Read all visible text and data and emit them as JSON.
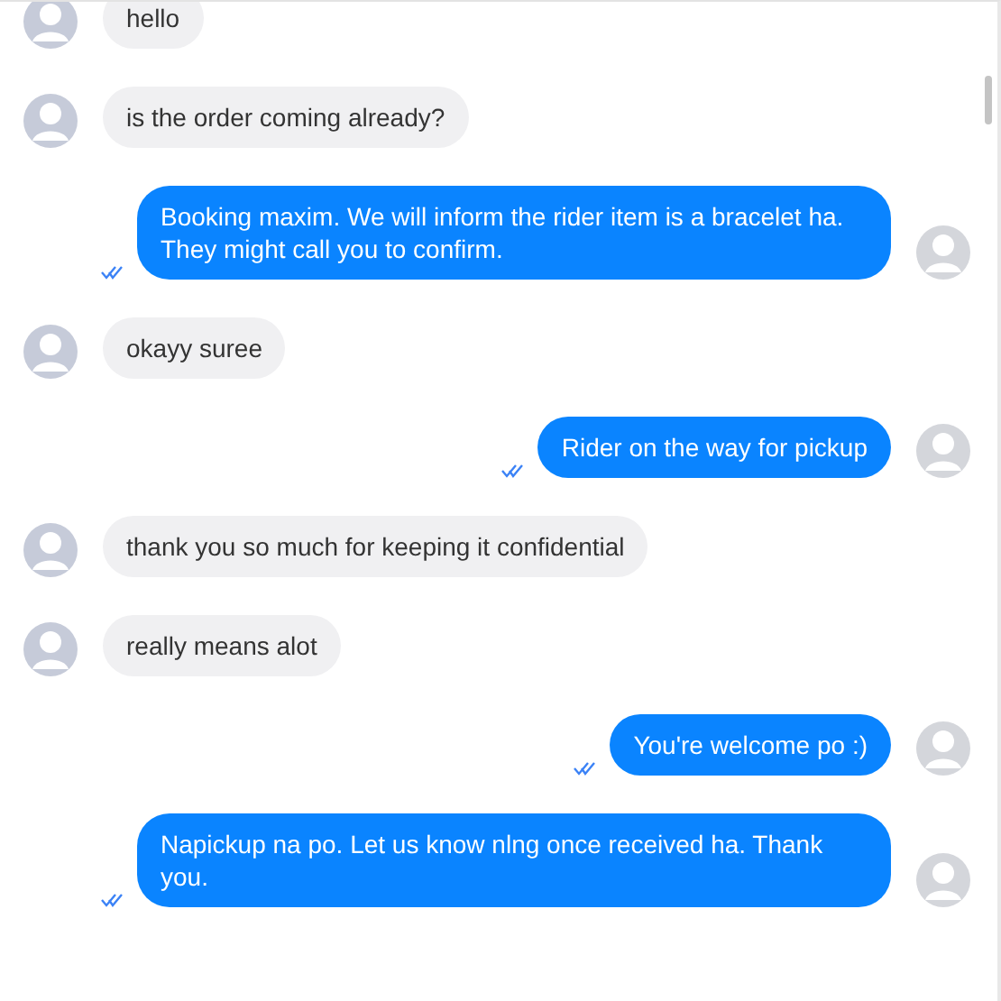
{
  "messages": [
    {
      "kind": "incoming",
      "text": "hello"
    },
    {
      "kind": "incoming",
      "text": "is the order coming already?"
    },
    {
      "kind": "outgoing",
      "text": "Booking maxim. We will inform the rider item is a bracelet ha. They might call you to confirm.",
      "seen": true
    },
    {
      "kind": "incoming",
      "text": "okayy suree"
    },
    {
      "kind": "outgoing",
      "text": "Rider on the way for pickup",
      "seen": true
    },
    {
      "kind": "incoming",
      "text": "thank you so much for keeping it confidential"
    },
    {
      "kind": "incoming",
      "text": "really means alot"
    },
    {
      "kind": "outgoing",
      "text": "You're welcome po :)",
      "seen": true
    },
    {
      "kind": "outgoing",
      "text": "Napickup na po. Let us know nlng once received ha. Thank you.",
      "seen": true
    }
  ]
}
